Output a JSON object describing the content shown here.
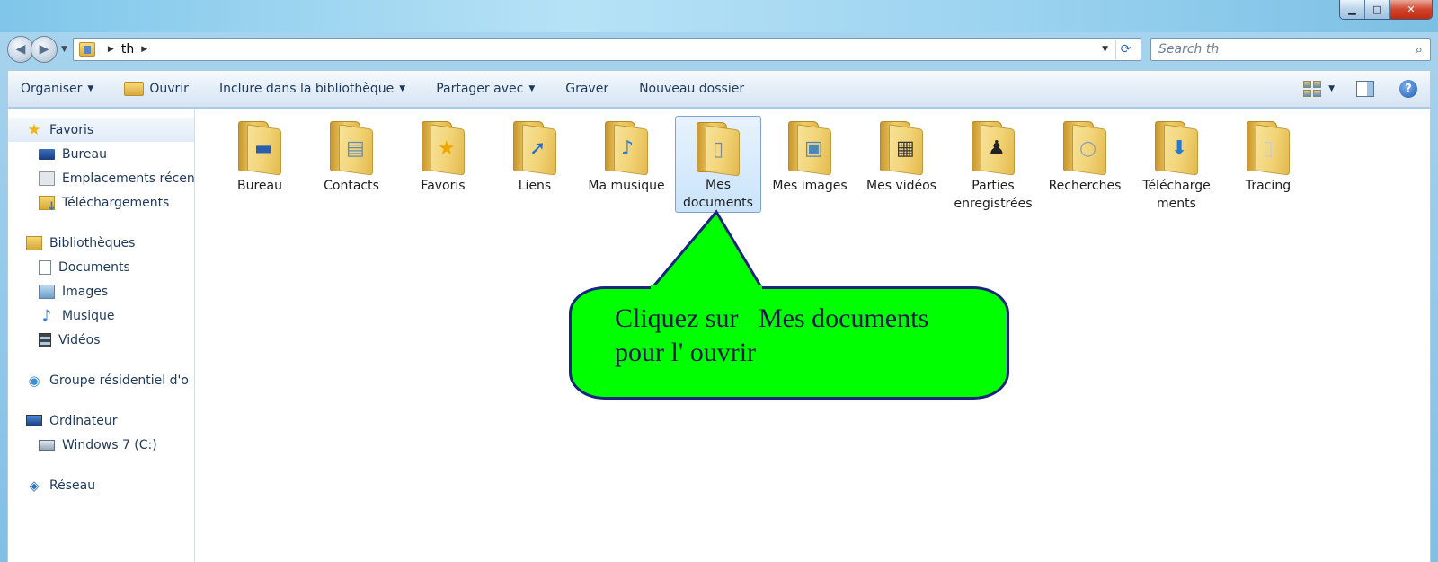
{
  "window": {
    "minimize_glyph": "▁",
    "maximize_glyph": "□",
    "close_glyph": "✕"
  },
  "address": {
    "crumbs": [
      "th"
    ],
    "search_placeholder": "Search th"
  },
  "toolbar": {
    "organise": "Organiser",
    "open": "Ouvrir",
    "include": "Inclure dans la bibliothèque",
    "share": "Partager avec",
    "burn": "Graver",
    "new_folder": "Nouveau dossier"
  },
  "nav": {
    "favorites": {
      "label": "Favoris",
      "items": [
        "Bureau",
        "Emplacements récents",
        "Téléchargements"
      ]
    },
    "libraries": {
      "label": "Bibliothèques",
      "items": [
        "Documents",
        "Images",
        "Musique",
        "Vidéos"
      ]
    },
    "homegroup": "Groupe résidentiel d'o",
    "computer": {
      "label": "Ordinateur",
      "items": [
        "Windows 7 (C:)"
      ]
    },
    "network": "Réseau"
  },
  "folders": [
    {
      "label": "Bureau",
      "icon": "desktop-icon"
    },
    {
      "label": "Contacts",
      "icon": "contact-card-icon"
    },
    {
      "label": "Favoris",
      "icon": "star-icon"
    },
    {
      "label": "Liens",
      "icon": "shortcut-arrow-icon"
    },
    {
      "label": "Ma musique",
      "icon": "music-note-icon"
    },
    {
      "label": "Mes documents",
      "icon": "document-icon",
      "selected": true
    },
    {
      "label": "Mes images",
      "icon": "picture-icon"
    },
    {
      "label": "Mes vidéos",
      "icon": "film-icon"
    },
    {
      "label": "Parties enregistrées",
      "icon": "chess-piece-icon"
    },
    {
      "label": "Recherches",
      "icon": "magnifier-icon"
    },
    {
      "label": "Télécharge ments",
      "icon": "download-arrow-icon"
    },
    {
      "label": "Tracing",
      "icon": "blank-page-icon"
    }
  ],
  "callout": {
    "line1": "Cliquez sur   Mes documents",
    "line2": "pour l' ouvrir",
    "fill": "#00ff00",
    "border": "#1a237e"
  }
}
